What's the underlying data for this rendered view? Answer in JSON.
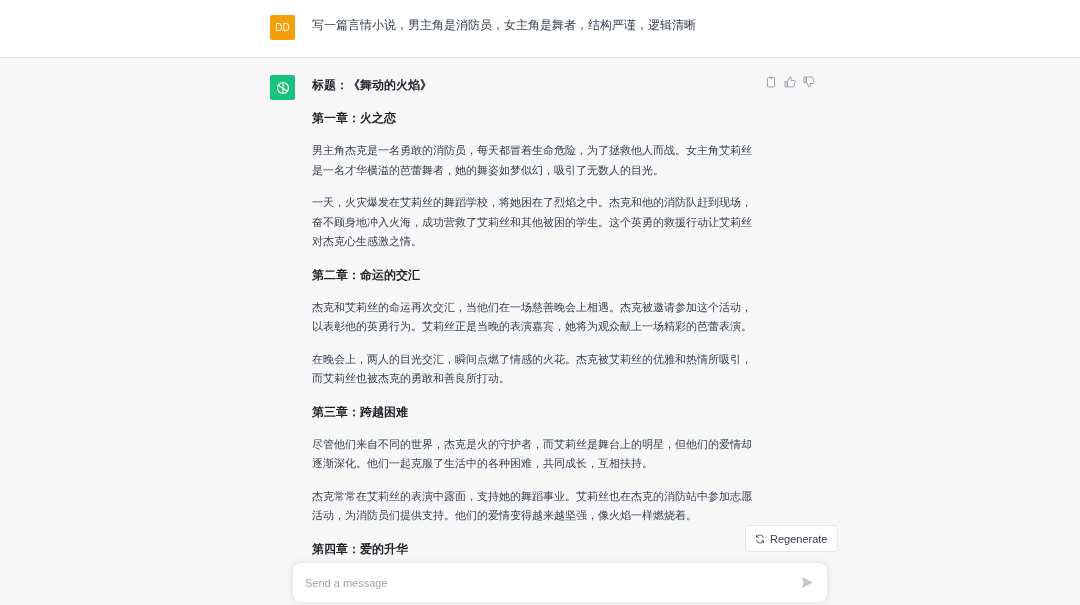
{
  "user_message": {
    "avatar": "DD",
    "text": "写一篇言情小说，男主角是消防员，女主角是舞者，结构严谨，逻辑清晰"
  },
  "assistant_message": {
    "blocks": [
      {
        "kind": "heading",
        "text": "标题：《舞动的火焰》"
      },
      {
        "kind": "heading",
        "text": "第一章：火之恋"
      },
      {
        "kind": "paragraph",
        "text": "男主角杰克是一名勇敢的消防员，每天都冒着生命危险，为了拯救他人而战。女主角艾莉丝是一名才华横溢的芭蕾舞者，她的舞姿如梦似幻，吸引了无数人的目光。"
      },
      {
        "kind": "paragraph",
        "text": "一天，火灾爆发在艾莉丝的舞蹈学校，将她困在了烈焰之中。杰克和他的消防队赶到现场，奋不顾身地冲入火海，成功营救了艾莉丝和其他被困的学生。这个英勇的救援行动让艾莉丝对杰克心生感激之情。"
      },
      {
        "kind": "heading",
        "text": "第二章：命运的交汇"
      },
      {
        "kind": "paragraph",
        "text": "杰克和艾莉丝的命运再次交汇，当他们在一场慈善晚会上相遇。杰克被邀请参加这个活动，以表彰他的英勇行为。艾莉丝正是当晚的表演嘉宾，她将为观众献上一场精彩的芭蕾表演。"
      },
      {
        "kind": "paragraph",
        "text": "在晚会上，两人的目光交汇，瞬间点燃了情感的火花。杰克被艾莉丝的优雅和热情所吸引，而艾莉丝也被杰克的勇敢和善良所打动。"
      },
      {
        "kind": "heading",
        "text": "第三章：跨越困难"
      },
      {
        "kind": "paragraph",
        "text": "尽管他们来自不同的世界，杰克是火的守护者，而艾莉丝是舞台上的明星，但他们的爱情却逐渐深化。他们一起克服了生活中的各种困难，共同成长，互相扶持。"
      },
      {
        "kind": "paragraph",
        "text": "杰克常常在艾莉丝的表演中露面，支持她的舞蹈事业。艾莉丝也在杰克的消防站中参加志愿活动，为消防员们提供支持。他们的爱情变得越来越坚强，像火焰一样燃烧着。"
      },
      {
        "kind": "heading",
        "text": "第四章：爱的升华"
      }
    ]
  },
  "regenerate_button": {
    "label": "Regenerate"
  },
  "composer": {
    "placeholder": "Send a message"
  }
}
